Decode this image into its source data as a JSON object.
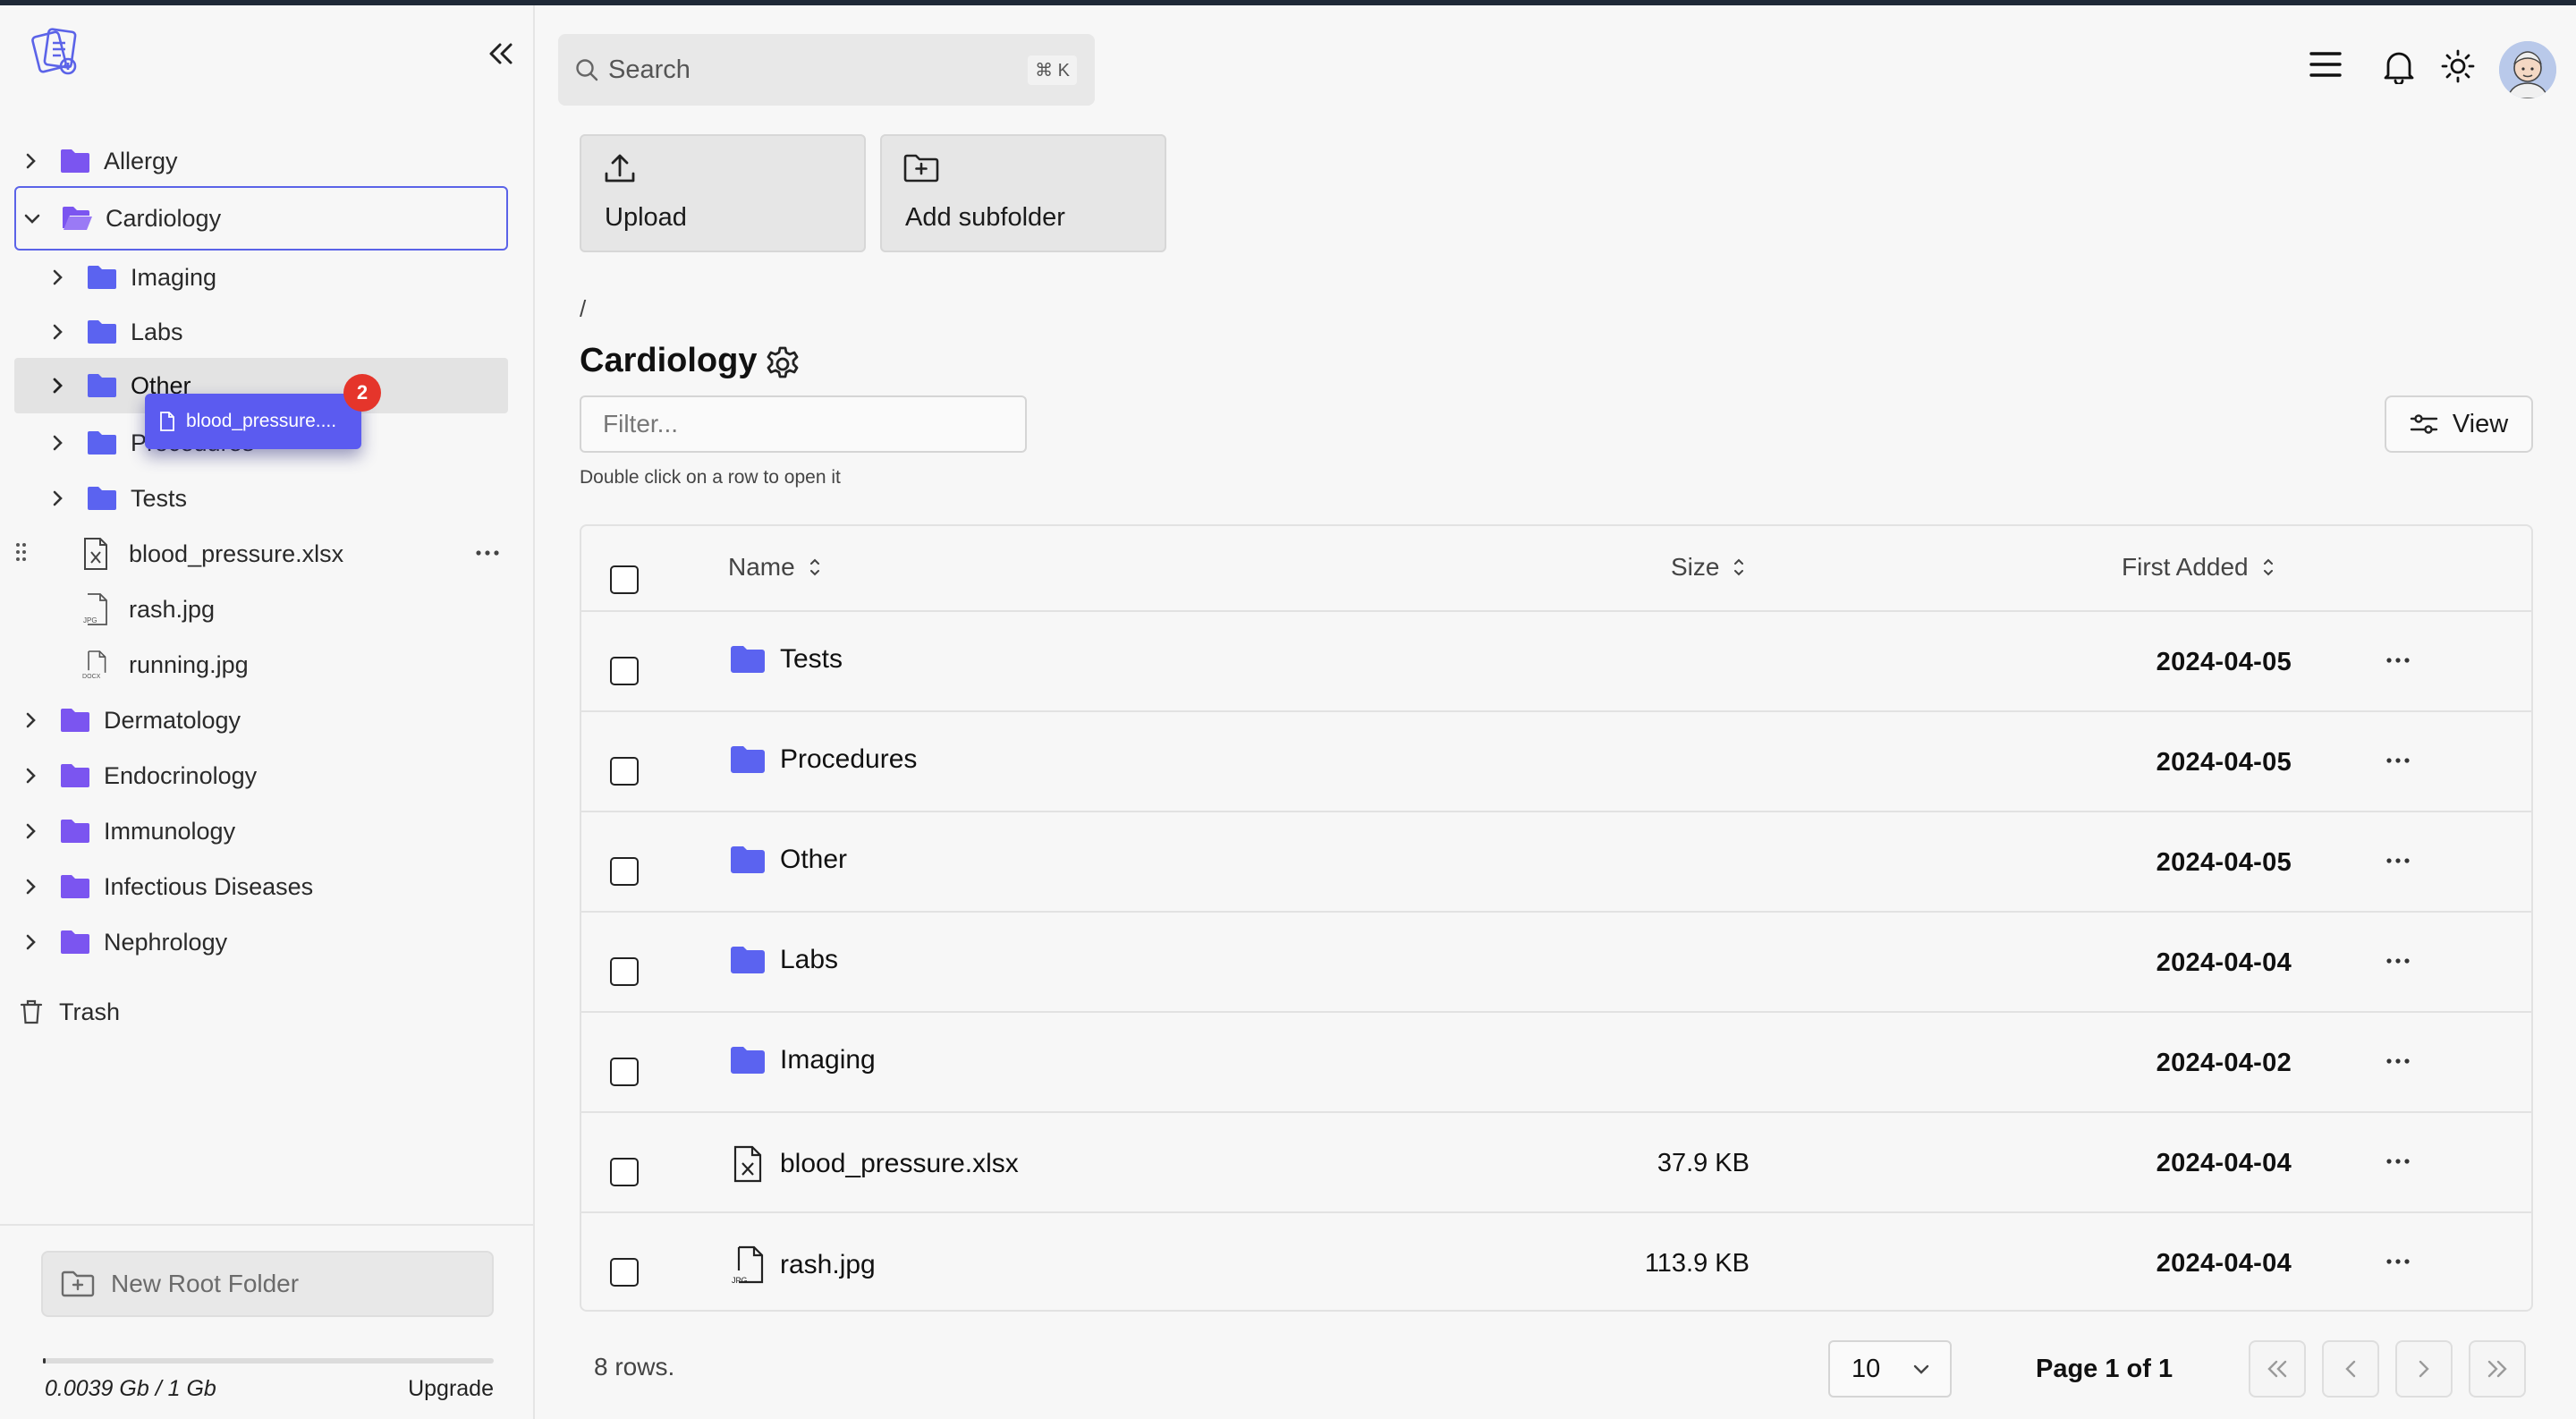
{
  "colors": {
    "accent": "#5b5bf0",
    "folder": "#5b63f0",
    "badge": "#e5352b"
  },
  "search": {
    "placeholder": "Search",
    "shortcut": "⌘ K"
  },
  "sidebar": {
    "tree": [
      {
        "label": "Allergy",
        "type": "folder"
      },
      {
        "label": "Cardiology",
        "type": "folder-open",
        "selected": true
      },
      {
        "label": "Imaging",
        "type": "folder"
      },
      {
        "label": "Labs",
        "type": "folder"
      },
      {
        "label": "Other",
        "type": "folder"
      },
      {
        "label": "Procedures",
        "type": "folder"
      },
      {
        "label": "Tests",
        "type": "folder"
      },
      {
        "label": "blood_pressure.xlsx",
        "type": "file-xlsx"
      },
      {
        "label": "rash.jpg",
        "type": "file-jpg"
      },
      {
        "label": "running.jpg",
        "type": "file-docx"
      },
      {
        "label": "Dermatology",
        "type": "folder"
      },
      {
        "label": "Endocrinology",
        "type": "folder"
      },
      {
        "label": "Immunology",
        "type": "folder"
      },
      {
        "label": "Infectious Diseases",
        "type": "folder"
      },
      {
        "label": "Nephrology",
        "type": "folder"
      }
    ],
    "trash_label": "Trash",
    "drag": {
      "label": "blood_pressure....",
      "count": "2"
    },
    "new_root_label": "New Root Folder",
    "storage_text": "0.0039 Gb / 1 Gb",
    "storage_fraction": 0.0039,
    "upgrade_label": "Upgrade",
    "file_tags": {
      "jpg": "JPG",
      "docx": "DOCX"
    }
  },
  "actions": {
    "upload_label": "Upload",
    "add_subfolder_label": "Add subfolder"
  },
  "main": {
    "breadcrumb": "/",
    "title": "Cardiology",
    "filter_placeholder": "Filter...",
    "hint": "Double click on a row to open it",
    "view_label": "View"
  },
  "table": {
    "headers": {
      "name": "Name",
      "size": "Size",
      "first_added": "First Added"
    },
    "rows": [
      {
        "name": "Tests",
        "type": "folder",
        "size": "",
        "date": "2024-04-05"
      },
      {
        "name": "Procedures",
        "type": "folder",
        "size": "",
        "date": "2024-04-05"
      },
      {
        "name": "Other",
        "type": "folder",
        "size": "",
        "date": "2024-04-05"
      },
      {
        "name": "Labs",
        "type": "folder",
        "size": "",
        "date": "2024-04-04"
      },
      {
        "name": "Imaging",
        "type": "folder",
        "size": "",
        "date": "2024-04-02"
      },
      {
        "name": "blood_pressure.xlsx",
        "type": "xlsx",
        "size": "37.9 KB",
        "date": "2024-04-04"
      },
      {
        "name": "rash.jpg",
        "type": "jpg",
        "size": "113.9 KB",
        "date": "2024-04-04"
      }
    ]
  },
  "footer": {
    "rows_count": "8 rows.",
    "page_size": "10",
    "page_info": "Page 1 of 1"
  }
}
